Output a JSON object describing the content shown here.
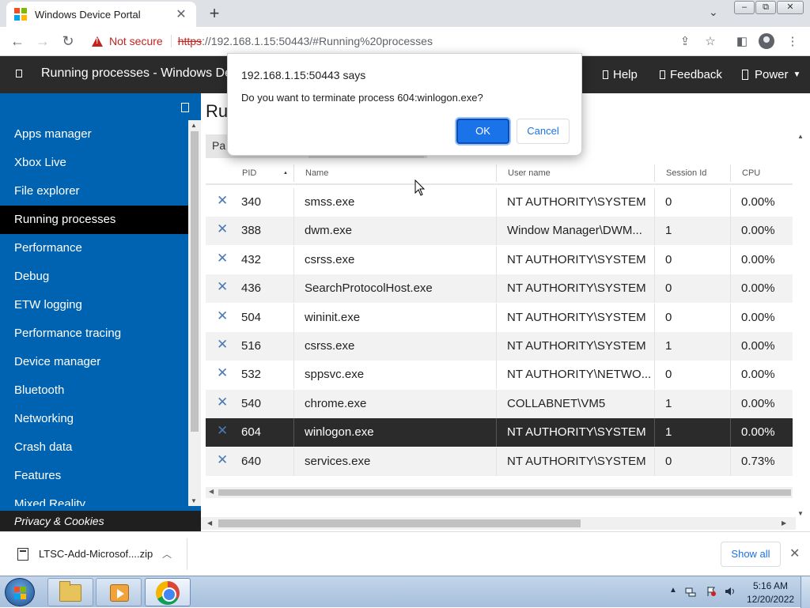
{
  "browser": {
    "tab_title": "Windows Device Portal",
    "tab_close": "✕",
    "new_tab": "+",
    "not_secure": "Not secure",
    "url_scheme": "https",
    "url_rest": "://192.168.1.15:50443/#Running%20processes",
    "windows_logo_colors": [
      "#f25022",
      "#7fba00",
      "#00a4ef",
      "#ffb900"
    ]
  },
  "header": {
    "title": "Running processes - Windows Devic",
    "help": "Help",
    "feedback": "Feedback",
    "power": "Power"
  },
  "sidebar": {
    "items": [
      {
        "label": "Apps manager"
      },
      {
        "label": "Xbox Live"
      },
      {
        "label": "File explorer"
      },
      {
        "label": "Running processes",
        "active": true
      },
      {
        "label": "Performance"
      },
      {
        "label": "Debug"
      },
      {
        "label": "ETW logging"
      },
      {
        "label": "Performance tracing"
      },
      {
        "label": "Device manager"
      },
      {
        "label": "Bluetooth"
      },
      {
        "label": "Networking"
      },
      {
        "label": "Crash data"
      },
      {
        "label": "Features"
      },
      {
        "label": "Mixed Reality"
      }
    ],
    "footer": "Privacy & Cookies",
    "accent": "#0063b1"
  },
  "content": {
    "title": "Ru",
    "tab_first": "Pa"
  },
  "table": {
    "columns": [
      "PID",
      "Name",
      "User name",
      "Session Id",
      "CPU"
    ],
    "rows": [
      {
        "pid": "340",
        "name": "smss.exe",
        "user": "NT AUTHORITY\\SYSTEM",
        "session": "0",
        "cpu": "0.00%"
      },
      {
        "pid": "388",
        "name": "dwm.exe",
        "user": "Window Manager\\DWM...",
        "session": "1",
        "cpu": "0.00%"
      },
      {
        "pid": "432",
        "name": "csrss.exe",
        "user": "NT AUTHORITY\\SYSTEM",
        "session": "0",
        "cpu": "0.00%"
      },
      {
        "pid": "436",
        "name": "SearchProtocolHost.exe",
        "user": "NT AUTHORITY\\SYSTEM",
        "session": "0",
        "cpu": "0.00%"
      },
      {
        "pid": "504",
        "name": "wininit.exe",
        "user": "NT AUTHORITY\\SYSTEM",
        "session": "0",
        "cpu": "0.00%"
      },
      {
        "pid": "516",
        "name": "csrss.exe",
        "user": "NT AUTHORITY\\SYSTEM",
        "session": "1",
        "cpu": "0.00%"
      },
      {
        "pid": "532",
        "name": "sppsvc.exe",
        "user": "NT AUTHORITY\\NETWO...",
        "session": "0",
        "cpu": "0.00%"
      },
      {
        "pid": "540",
        "name": "chrome.exe",
        "user": "COLLABNET\\VM5",
        "session": "1",
        "cpu": "0.00%"
      },
      {
        "pid": "604",
        "name": "winlogon.exe",
        "user": "NT AUTHORITY\\SYSTEM",
        "session": "1",
        "cpu": "0.00%",
        "selected": true
      },
      {
        "pid": "640",
        "name": "services.exe",
        "user": "NT AUTHORITY\\SYSTEM",
        "session": "0",
        "cpu": "0.73%"
      }
    ]
  },
  "dialog": {
    "origin": "192.168.1.15:50443 says",
    "message": "Do you want to terminate process 604:winlogon.exe?",
    "ok": "OK",
    "cancel": "Cancel"
  },
  "downloads": {
    "file_name": "LTSC-Add-Microsof....zip",
    "show_all": "Show all"
  },
  "taskbar": {
    "time": "5:16 AM",
    "date": "12/20/2022"
  }
}
